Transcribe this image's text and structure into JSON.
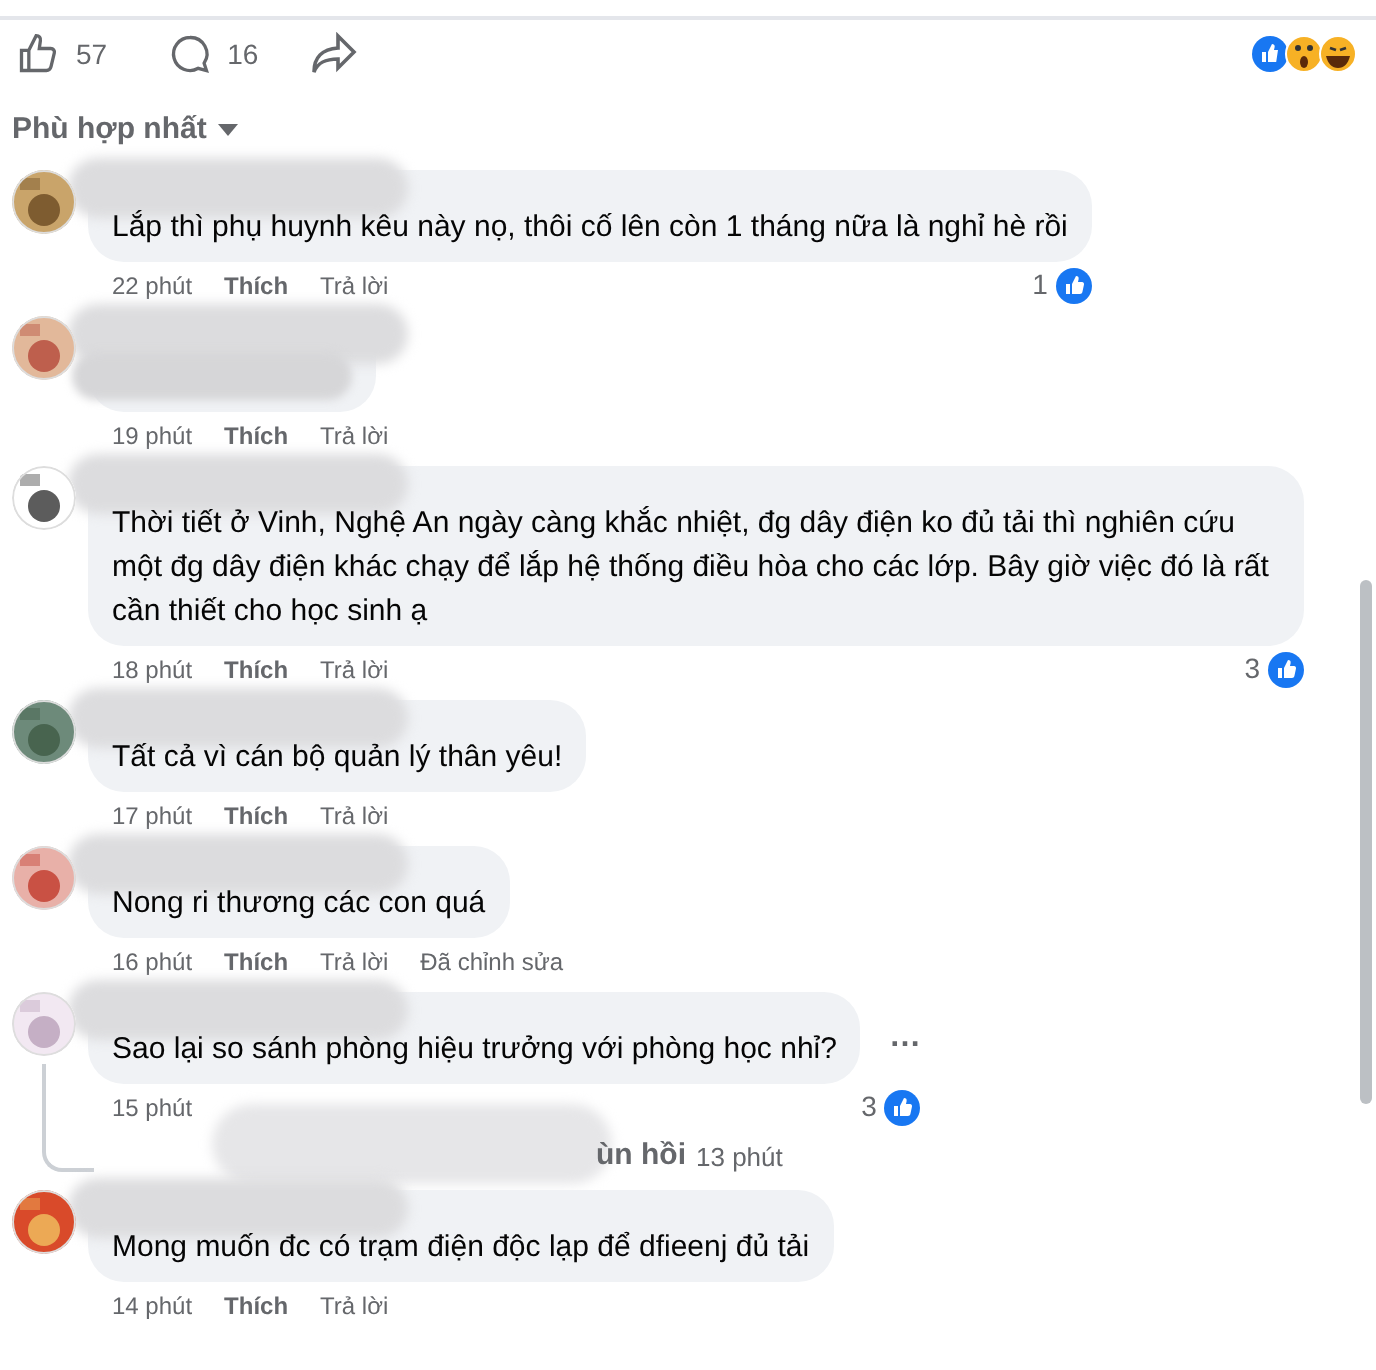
{
  "post_bar": {
    "like_count": "57",
    "comment_count": "16"
  },
  "sort": {
    "label": "Phù hợp nhất"
  },
  "comments": [
    {
      "kind": "text",
      "text": "Lắp thì phụ huynh kêu này nọ, thôi cố lên còn 1 tháng nữa là nghỉ hè rồi",
      "time": "22 phút",
      "actions": [
        "Thích",
        "Trả lời"
      ],
      "reaction_count": "1"
    },
    {
      "kind": "blurred",
      "time": "19 phút",
      "actions": [
        "Thích",
        "Trả lời"
      ]
    },
    {
      "kind": "text",
      "text": "Thời tiết ở Vinh, Nghệ An ngày càng khắc nhiệt, đg dây điện ko đủ tải thì nghiên cứu một đg dây điện khác chạy để lắp hệ thống điều hòa cho các lớp. Bây giờ việc đó là rất cần thiết cho học sinh ạ",
      "time": "18 phút",
      "actions": [
        "Thích",
        "Trả lời"
      ],
      "reaction_count": "3"
    },
    {
      "kind": "text",
      "text": "Tất cả vì cán bộ quản lý thân yêu!",
      "time": "17 phút",
      "actions": [
        "Thích",
        "Trả lời"
      ]
    },
    {
      "kind": "text",
      "text": "Nong ri thương các con quá",
      "time": "16 phút",
      "actions": [
        "Thích",
        "Trả lời"
      ],
      "edited": "Đã chỉnh sửa"
    },
    {
      "kind": "text",
      "text": "Sao lại so sánh phòng hiệu trưởng với phòng học nhỉ?",
      "time": "15 phút",
      "reaction_count": "3",
      "more": "…",
      "replies": {
        "label": "ùn hồi",
        "time": "13 phút"
      }
    },
    {
      "kind": "text",
      "text": "Mong muốn đc có trạm điện độc lạp để dfieenj đủ tải",
      "time": "14 phút",
      "actions": [
        "Thích",
        "Trả lời"
      ]
    }
  ]
}
